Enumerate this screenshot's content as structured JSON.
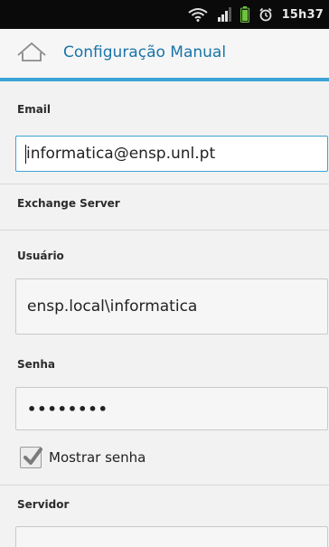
{
  "status_bar": {
    "time": "15h37",
    "icons": [
      "wifi-icon",
      "signal-icon",
      "battery-icon",
      "alarm-icon"
    ]
  },
  "action_bar": {
    "icon": "home-icon",
    "title": "Configuração Manual"
  },
  "form": {
    "email": {
      "label": "Email",
      "value": "informatica@ensp.unl.pt"
    },
    "exchange_header": "Exchange Server",
    "usuario": {
      "label": "Usuário",
      "value": "ensp.local\\informatica"
    },
    "senha": {
      "label": "Senha",
      "value": "••••••••"
    },
    "mostrar_senha": {
      "label": "Mostrar senha",
      "checked": true
    },
    "servidor": {
      "label": "Servidor"
    }
  },
  "colors": {
    "accent": "#3aa4d6",
    "title": "#1a74a8",
    "status_bar": "#0a0a0a",
    "battery": "#6dc33a"
  }
}
